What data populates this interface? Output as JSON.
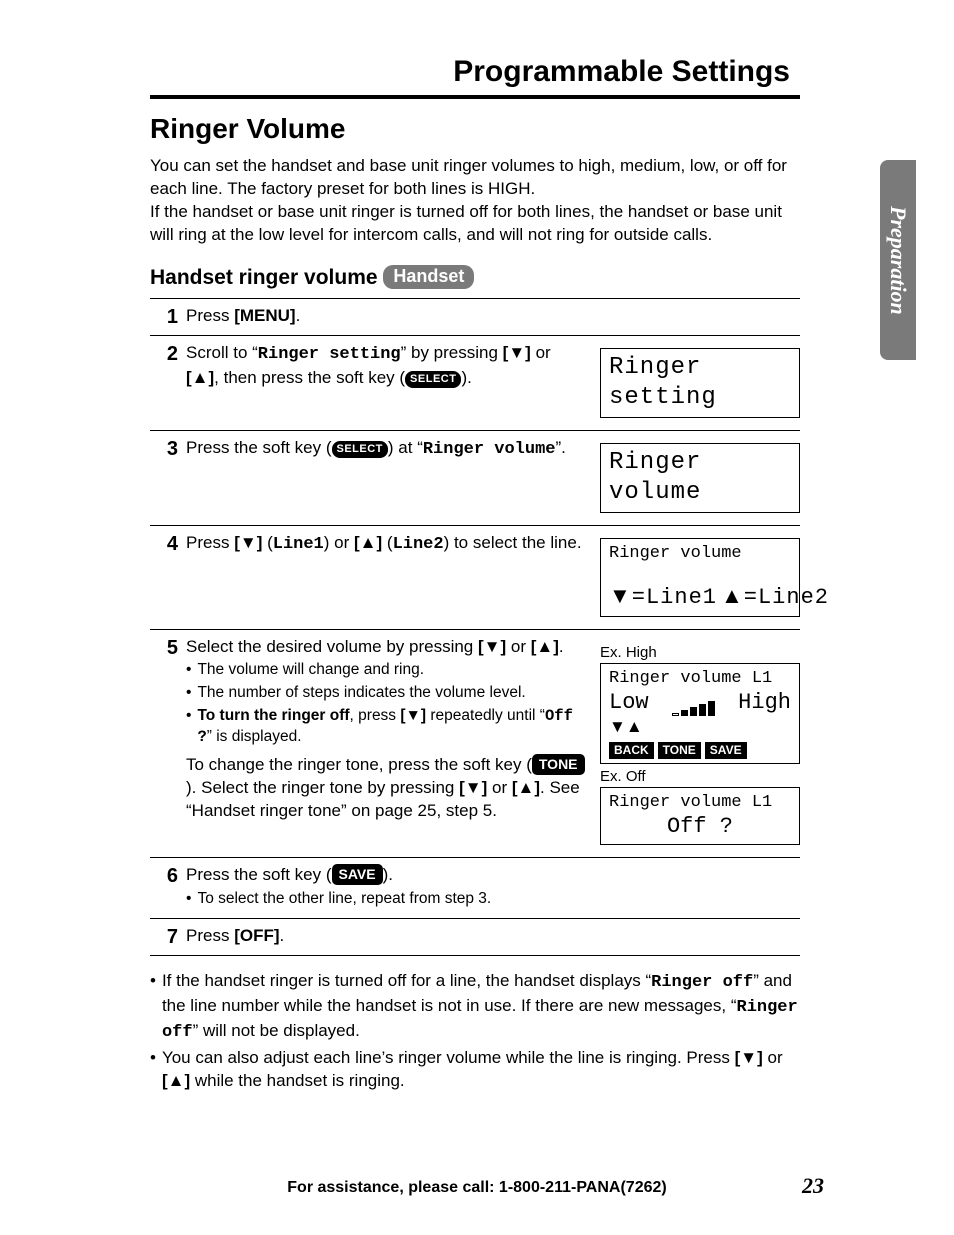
{
  "header": {
    "title": "Programmable Settings"
  },
  "side_tab": "Preparation",
  "h2": "Ringer Volume",
  "intro": "You can set the handset and base unit ringer volumes to high, medium, low, or off for each line. The factory preset for both lines is HIGH.\nIf the handset or base unit ringer is turned off for both lines, the handset or base unit will ring at the low level for intercom calls, and will not ring for outside calls.",
  "h3_prefix": "Handset ringer volume",
  "handset_pill": "Handset",
  "select_pill": "SELECT",
  "keys": {
    "menu": "[MENU]",
    "off": "[OFF]"
  },
  "mono": {
    "ringer_setting": "Ringer setting",
    "ringer_volume": "Ringer volume",
    "line1": "Line1",
    "line2": "Line2",
    "off_q": "Off ?",
    "ringer_off": "Ringer off"
  },
  "softkeys": {
    "tone": "TONE",
    "save": "SAVE",
    "back": "BACK"
  },
  "steps": {
    "s1": {
      "num": "1",
      "t1": "Press ",
      "t2": "."
    },
    "s2": {
      "num": "2",
      "t1": "Scroll to “",
      "t2": "” by pressing ",
      "t3": " or ",
      "t4": ", then press the soft key (",
      "t5": ")."
    },
    "s3": {
      "num": "3",
      "t1": "Press the soft key (",
      "t2": ") at “",
      "t3": "”."
    },
    "s4": {
      "num": "4",
      "t1": "Press ",
      "t2": " (",
      "t3": ") or ",
      "t4": " (",
      "t5": ") to select the line."
    },
    "s5": {
      "num": "5",
      "t1": "Select the desired volume by pressing ",
      "t2": " or ",
      "t3": ".",
      "b1": "The volume will change and ring.",
      "b2": "The number of steps indicates the volume level.",
      "b3a": "To turn the ringer off",
      "b3b": ", press ",
      "b3c": " repeatedly until “",
      "b3d": "” is displayed.",
      "sub1": "To change the ringer tone, press the soft key (",
      "sub2": "). Select the ringer tone by pressing ",
      "sub3": " or ",
      "sub4": ". See “Handset ringer tone” on page 25, step 5."
    },
    "s6": {
      "num": "6",
      "t1": "Press the soft key (",
      "t2": ").",
      "b1": "To select the other line, repeat from step 3."
    },
    "s7": {
      "num": "7",
      "t1": "Press ",
      "t2": "."
    }
  },
  "lcd": {
    "s2": "Ringer setting",
    "s3": "Ringer volume",
    "s4_line1": "Ringer volume",
    "s4_l": "=Line1",
    "s4_r": "=Line2",
    "ex_high": "Ex. High",
    "s5a_l1": "Ringer volume L1",
    "s5a_low": "Low",
    "s5a_high": "High",
    "ex_off": "Ex. Off",
    "s5b_l1": "Ringer volume L1",
    "s5b_off": "Off ?"
  },
  "notes": {
    "n1a": "If the handset ringer is turned off for a line, the handset displays “",
    "n1b": "” and the line number while the handset is not in use. If there are new messages, “",
    "n1c": "” will not be displayed.",
    "n2a": "You can also adjust each line’s ringer volume while the line is ringing. Press ",
    "n2b": " or ",
    "n2c": " while the handset is ringing."
  },
  "footer": "For assistance, please call: 1-800-211-PANA(7262)",
  "page_number": "23"
}
